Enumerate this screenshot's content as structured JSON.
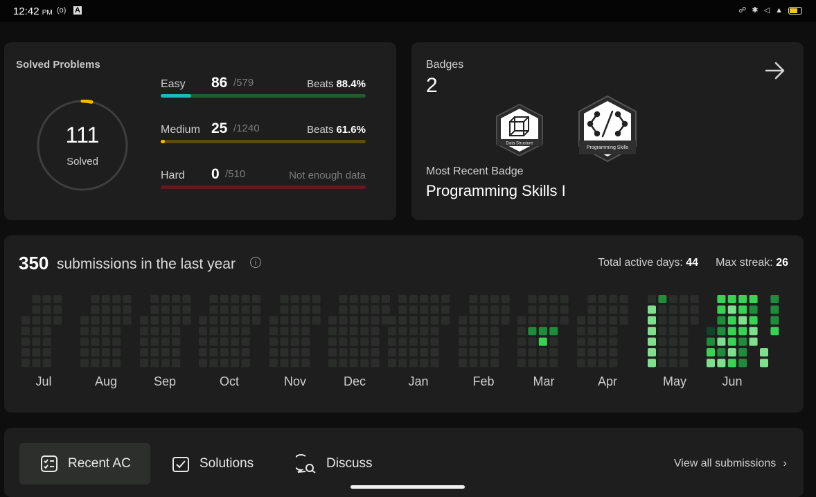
{
  "status_bar": {
    "time": "12:42",
    "ampm": "PM",
    "left_icons": [
      "hotspot-icon",
      "app-notification-icon"
    ],
    "right_icons": [
      "headphones-icon",
      "bluetooth-icon",
      "vibrate-mute-icon",
      "wifi-icon",
      "battery-icon"
    ]
  },
  "solved": {
    "title": "Solved Problems",
    "count": "111",
    "label": "Solved",
    "progress_fraction": 0.0326,
    "difficulties": [
      {
        "name": "Easy",
        "count": "86",
        "total": "/579",
        "beats_label": "Beats",
        "beats_value": "88.4%",
        "fraction": 0.1485,
        "color": "#1cbaba",
        "track": "#1f5e2f"
      },
      {
        "name": "Medium",
        "count": "25",
        "total": "/1240",
        "beats_label": "Beats",
        "beats_value": "61.6%",
        "fraction": 0.0202,
        "color": "#ffb800",
        "track": "#5e4a12"
      },
      {
        "name": "Hard",
        "count": "0",
        "total": "/510",
        "note": "Not enough data",
        "fraction": 0,
        "color": "#ef4743",
        "track": "#5c1d1c"
      }
    ]
  },
  "badges": {
    "label": "Badges",
    "count": "2",
    "items": [
      {
        "name": "Data Structure",
        "icon": "cube-icon"
      },
      {
        "name": "Programming Skills",
        "icon": "code-brackets-icon"
      }
    ],
    "recent_label": "Most Recent Badge",
    "recent_name": "Programming Skills I"
  },
  "heatmap": {
    "count": "350",
    "caption": "submissions in the last year",
    "total_active_label": "Total active days:",
    "total_active_value": "44",
    "max_streak_label": "Max streak:",
    "max_streak_value": "26",
    "months": [
      "Jul",
      "Aug",
      "Sep",
      "Oct",
      "Nov",
      "Dec",
      "Jan",
      "Feb",
      "Mar",
      "Apr",
      "May",
      "Jun"
    ],
    "colors": {
      "empty": "#2b2d2b",
      "l1": "#0e4429",
      "l2": "#1e8c3a",
      "l3": "#39d353",
      "l4": "#7ee08d"
    },
    "active_cells": [
      {
        "month": "Mar",
        "col": 1,
        "row": 3,
        "level": "l2"
      },
      {
        "month": "Mar",
        "col": 2,
        "row": 3,
        "level": "l2"
      },
      {
        "month": "Mar",
        "col": 3,
        "row": 3,
        "level": "l2"
      },
      {
        "month": "Mar",
        "col": 2,
        "row": 4,
        "level": "l3"
      },
      {
        "month": "May",
        "col": 0,
        "row": 1,
        "level": "l4"
      },
      {
        "month": "May",
        "col": 1,
        "row": 0,
        "level": "l2"
      },
      {
        "month": "May",
        "col": 0,
        "row": 2,
        "level": "l4"
      },
      {
        "month": "May",
        "col": 0,
        "row": 3,
        "level": "l4"
      },
      {
        "month": "May",
        "col": 0,
        "row": 4,
        "level": "l4"
      },
      {
        "month": "May",
        "col": 0,
        "row": 5,
        "level": "l4"
      },
      {
        "month": "May",
        "col": 0,
        "row": 6,
        "level": "l4"
      },
      {
        "month": "Jun",
        "col": 1,
        "row": 0,
        "level": "l3"
      },
      {
        "month": "Jun",
        "col": 2,
        "row": 0,
        "level": "l3"
      },
      {
        "month": "Jun",
        "col": 3,
        "row": 0,
        "level": "l3"
      },
      {
        "month": "Jun",
        "col": 4,
        "row": 0,
        "level": "l3"
      },
      {
        "month": "Jun",
        "col": 6,
        "row": 0,
        "level": "l2"
      },
      {
        "month": "Jun",
        "col": 1,
        "row": 1,
        "level": "l3"
      },
      {
        "month": "Jun",
        "col": 2,
        "row": 1,
        "level": "l4"
      },
      {
        "month": "Jun",
        "col": 3,
        "row": 1,
        "level": "l3"
      },
      {
        "month": "Jun",
        "col": 4,
        "row": 1,
        "level": "l2"
      },
      {
        "month": "Jun",
        "col": 6,
        "row": 1,
        "level": "l2"
      },
      {
        "month": "Jun",
        "col": 1,
        "row": 2,
        "level": "l2"
      },
      {
        "month": "Jun",
        "col": 2,
        "row": 2,
        "level": "l3"
      },
      {
        "month": "Jun",
        "col": 3,
        "row": 2,
        "level": "l4"
      },
      {
        "month": "Jun",
        "col": 4,
        "row": 2,
        "level": "l3"
      },
      {
        "month": "Jun",
        "col": 6,
        "row": 2,
        "level": "l2"
      },
      {
        "month": "Jun",
        "col": 0,
        "row": 3,
        "level": "l1"
      },
      {
        "month": "Jun",
        "col": 1,
        "row": 3,
        "level": "l2"
      },
      {
        "month": "Jun",
        "col": 2,
        "row": 3,
        "level": "l3"
      },
      {
        "month": "Jun",
        "col": 3,
        "row": 3,
        "level": "l3"
      },
      {
        "month": "Jun",
        "col": 4,
        "row": 3,
        "level": "l4"
      },
      {
        "month": "Jun",
        "col": 6,
        "row": 3,
        "level": "l3"
      },
      {
        "month": "Jun",
        "col": 0,
        "row": 4,
        "level": "l2"
      },
      {
        "month": "Jun",
        "col": 1,
        "row": 4,
        "level": "l4"
      },
      {
        "month": "Jun",
        "col": 2,
        "row": 4,
        "level": "l3"
      },
      {
        "month": "Jun",
        "col": 3,
        "row": 4,
        "level": "l2"
      },
      {
        "month": "Jun",
        "col": 4,
        "row": 4,
        "level": "l4"
      },
      {
        "month": "Jun",
        "col": 0,
        "row": 5,
        "level": "l3"
      },
      {
        "month": "Jun",
        "col": 1,
        "row": 5,
        "level": "l2"
      },
      {
        "month": "Jun",
        "col": 2,
        "row": 5,
        "level": "l4"
      },
      {
        "month": "Jun",
        "col": 3,
        "row": 5,
        "level": "l2"
      },
      {
        "month": "Jun",
        "col": 5,
        "row": 5,
        "level": "l4"
      },
      {
        "month": "Jun",
        "col": 0,
        "row": 6,
        "level": "l4"
      },
      {
        "month": "Jun",
        "col": 1,
        "row": 6,
        "level": "l4"
      },
      {
        "month": "Jun",
        "col": 2,
        "row": 6,
        "level": "l3"
      },
      {
        "month": "Jun",
        "col": 3,
        "row": 6,
        "level": "l2"
      },
      {
        "month": "Jun",
        "col": 5,
        "row": 6,
        "level": "l4"
      }
    ]
  },
  "tabs": {
    "items": [
      {
        "label": "Recent AC",
        "icon": "checklist-icon",
        "active": true
      },
      {
        "label": "Solutions",
        "icon": "checkbox-icon",
        "active": false
      },
      {
        "label": "Discuss",
        "icon": "chat-search-icon",
        "active": false
      }
    ],
    "view_all": "View all submissions"
  }
}
